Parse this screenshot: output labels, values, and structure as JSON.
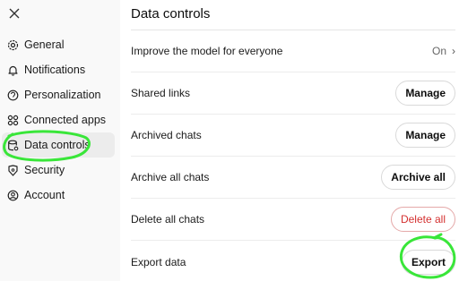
{
  "sidebar": {
    "close_icon": "close-icon",
    "items": [
      {
        "label": "General",
        "icon": "gear-icon"
      },
      {
        "label": "Notifications",
        "icon": "bell-icon"
      },
      {
        "label": "Personalization",
        "icon": "personalization-icon"
      },
      {
        "label": "Connected apps",
        "icon": "apps-icon"
      },
      {
        "label": "Data controls",
        "icon": "database-icon",
        "active": true
      },
      {
        "label": "Security",
        "icon": "shield-icon"
      },
      {
        "label": "Account",
        "icon": "account-icon"
      }
    ]
  },
  "main": {
    "title": "Data controls",
    "rows": [
      {
        "label": "Improve the model for everyone",
        "value": "On",
        "chevron": "›"
      },
      {
        "label": "Shared links",
        "button": "Manage"
      },
      {
        "label": "Archived chats",
        "button": "Manage"
      },
      {
        "label": "Archive all chats",
        "button": "Archive all"
      },
      {
        "label": "Delete all chats",
        "button": "Delete all",
        "danger": true
      },
      {
        "label": "Export data",
        "button": "Export"
      }
    ]
  },
  "colors": {
    "annotation": "#39e639",
    "danger": "#d4302f",
    "sidebar_bg": "#f9f9f9"
  }
}
